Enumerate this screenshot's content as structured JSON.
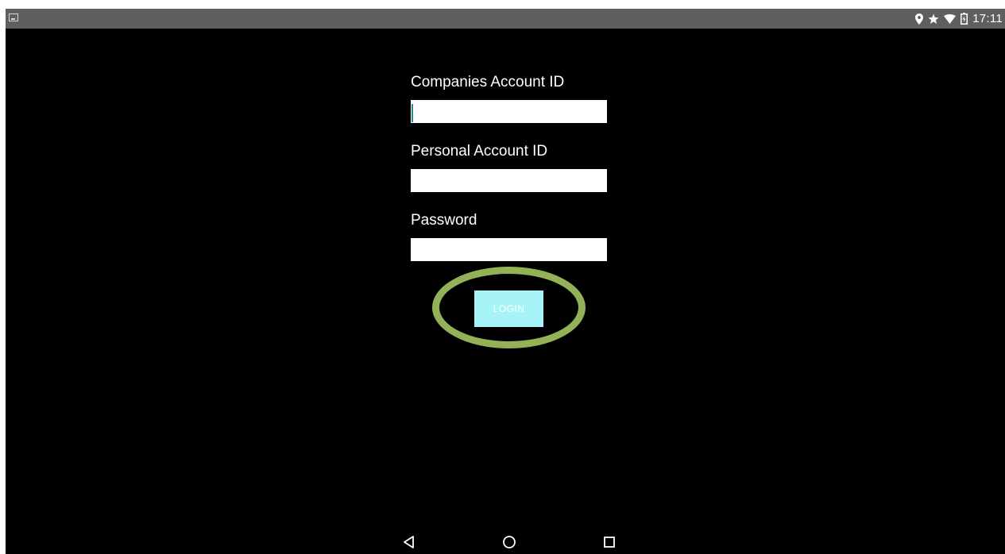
{
  "status_bar": {
    "time": "17:11",
    "icons": [
      "image-notification-icon",
      "location-icon",
      "star-icon",
      "wifi-icon",
      "battery-icon"
    ]
  },
  "form": {
    "company_label": "Companies Account ID",
    "company_value": "",
    "personal_label": "Personal Account ID",
    "personal_value": "",
    "password_label": "Password",
    "password_value": "",
    "login_label": "LOGIN"
  },
  "colors": {
    "background": "#000000",
    "status_bar": "#5f5f5f",
    "login_button": "#a6f4f8",
    "highlight_ring": "#93b257",
    "cursor": "#1f8f8c"
  },
  "nav_bar": {
    "icons": [
      "back-icon",
      "home-icon",
      "recents-icon"
    ]
  }
}
